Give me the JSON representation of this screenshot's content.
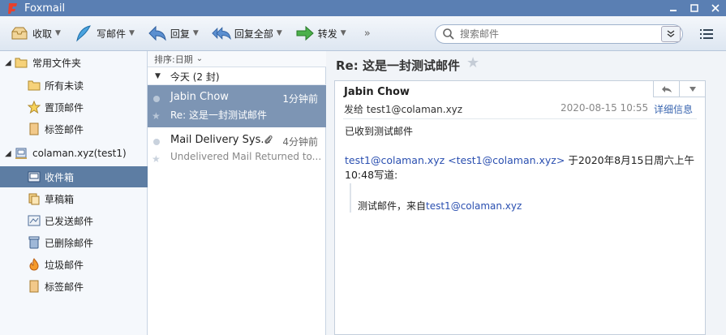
{
  "app": {
    "title": "Foxmail"
  },
  "toolbar": {
    "receive": "收取",
    "compose": "写邮件",
    "reply": "回复",
    "reply_all": "回复全部",
    "forward": "转发",
    "more": "»",
    "search_placeholder": "搜索邮件"
  },
  "sidebar": {
    "common_folder": "常用文件夹",
    "all_unread": "所有未读",
    "pinned": "置顶邮件",
    "tagged": "标签邮件",
    "account": "colaman.xyz(test1)",
    "inbox": "收件箱",
    "drafts": "草稿箱",
    "sent": "已发送邮件",
    "deleted": "已删除邮件",
    "junk": "垃圾邮件",
    "tagged2": "标签邮件"
  },
  "list": {
    "sort_label": "排序:日期",
    "group_label": "今天 (2 封)",
    "messages": [
      {
        "from": "Jabin Chow",
        "time": "1分钟前",
        "subject": "Re: 这是一封测试邮件"
      },
      {
        "from": "Mail Delivery Sys...",
        "time": "4分钟前",
        "subject": "Undelivered Mail Returned to..."
      }
    ]
  },
  "reading": {
    "title": "Re: 这是一封测试邮件",
    "sender": "Jabin Chow",
    "to_label": "发给 test1@colaman.xyz",
    "date": "2020-08-15 10:55",
    "detail_link": "详细信息",
    "body_line": "已收到测试邮件",
    "quote_email1": "test1@colaman.xyz",
    "quote_email2": "<test1@colaman.xyz>",
    "quote_text": " 于2020年8月15日周六上午10:48写道:",
    "quote_body_prefix": "测试邮件，来自",
    "quote_body_email": "test1@colaman.xyz"
  },
  "colors": {
    "accent": "#5a7fb3",
    "selection": "#5d7da3",
    "link": "#2a4fb0"
  }
}
